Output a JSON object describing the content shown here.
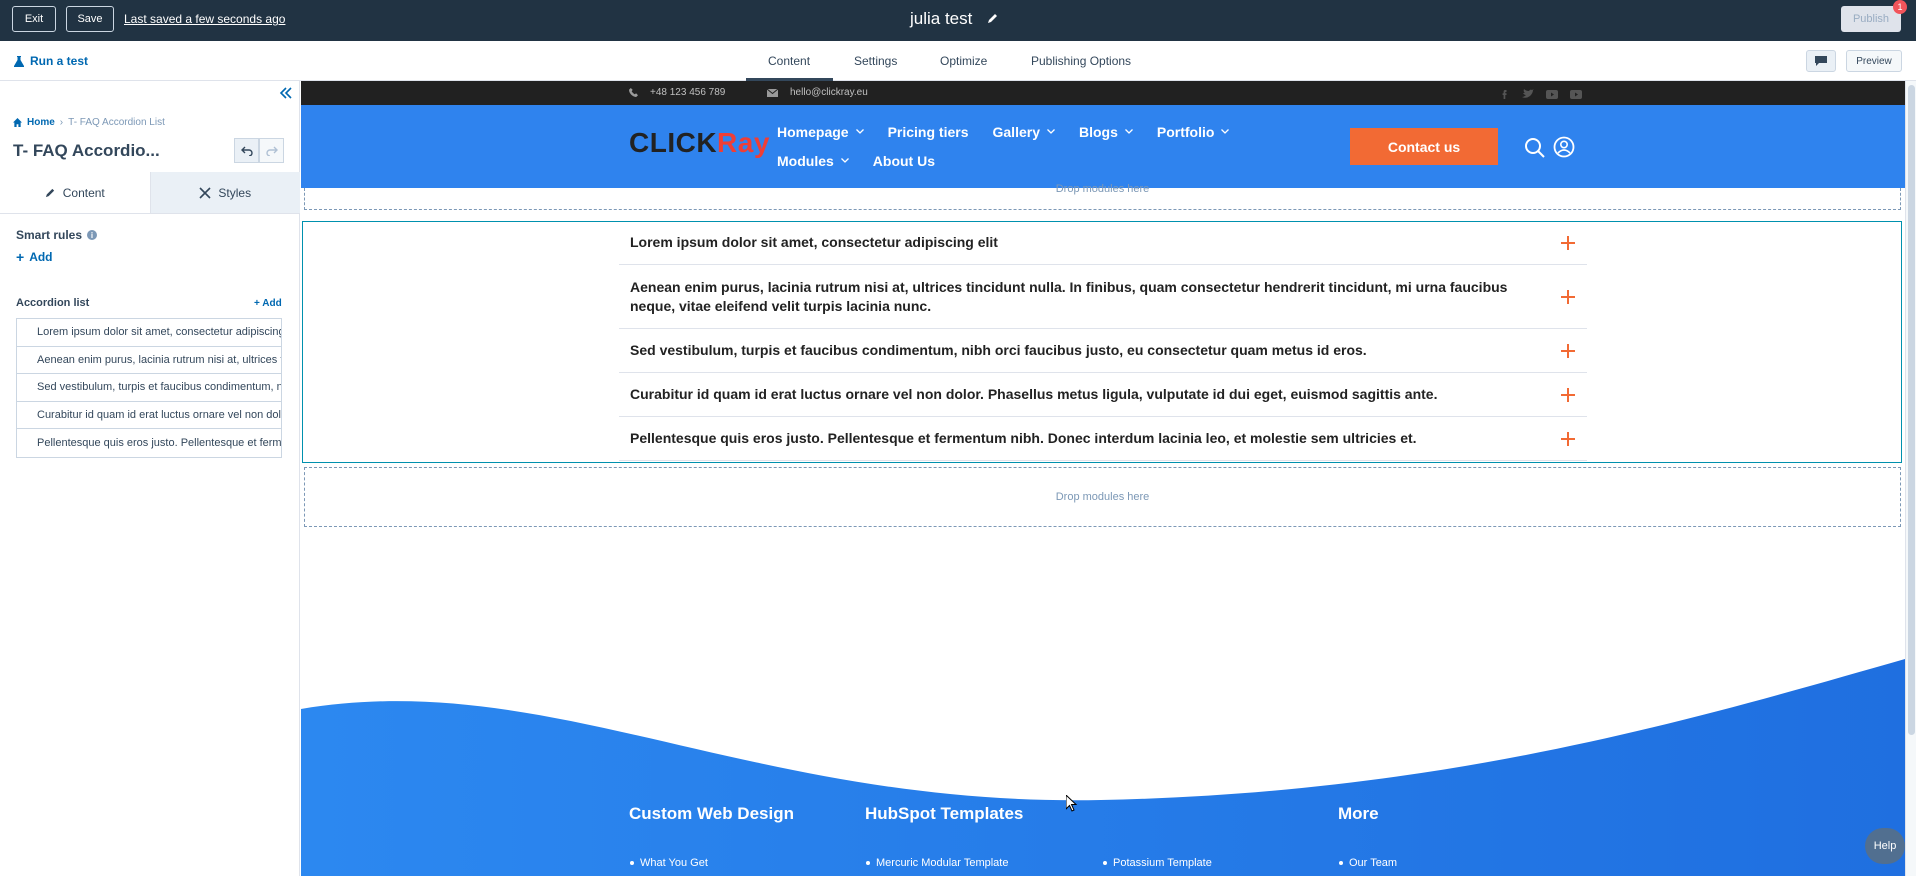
{
  "topbar": {
    "exit_label": "Exit",
    "save_label": "Save",
    "saved_status": "Last saved a few seconds ago",
    "page_title": "julia test",
    "publish_label": "Publish",
    "notification_count": "1"
  },
  "subbar": {
    "run_test_label": "Run a test",
    "tabs": [
      "Content",
      "Settings",
      "Optimize",
      "Publishing Options"
    ],
    "active_tab": "Content",
    "preview_label": "Preview"
  },
  "sidebar": {
    "breadcrumb": {
      "home": "Home",
      "current": "T- FAQ Accordion List"
    },
    "module_title": "T- FAQ Accordio...",
    "tabs": {
      "content": "Content",
      "styles": "Styles"
    },
    "smart_rules_label": "Smart rules",
    "add_label": "Add",
    "accordion_list_label": "Accordion list",
    "accordion_add_label": "+ Add",
    "accordion_items": [
      "Lorem ipsum dolor sit amet, consectetur adipiscing elit",
      "Aenean enim purus, lacinia rutrum nisi at, ultrices tincidunt nulla.",
      "Sed vestibulum, turpis et faucibus condimentum, nibh orci",
      "Curabitur id quam id erat luctus ornare vel non dolor.",
      "Pellentesque quis eros justo. Pellentesque et fermentum nibh."
    ]
  },
  "site": {
    "phone": "+48 123 456 789",
    "email": "hello@clickray.eu",
    "logo_main": "CLICK",
    "logo_accent": "Ray",
    "nav_row1": [
      "Homepage",
      "Pricing tiers",
      "Gallery",
      "Blogs",
      "Portfolio"
    ],
    "nav_row2": [
      "Modules",
      "About Us"
    ],
    "contact_label": "Contact us",
    "drop_modules_label": "Drop modules here",
    "faq_questions": [
      "Lorem ipsum dolor sit amet, consectetur adipiscing elit",
      "Aenean enim purus, lacinia rutrum nisi at, ultrices tincidunt nulla. In finibus, quam consectetur hendrerit tincidunt, mi urna faucibus neque, vitae eleifend velit turpis lacinia nunc.",
      "Sed vestibulum, turpis et faucibus condimentum, nibh orci faucibus justo, eu consectetur quam metus id eros.",
      "Curabitur id quam id erat luctus ornare vel non dolor. Phasellus metus ligula, vulputate id dui eget, euismod sagittis ante.",
      "Pellentesque quis eros justo. Pellentesque et fermentum nibh. Donec interdum lacinia leo, et molestie sem ultricies et."
    ],
    "footer": {
      "col1_heading": "Custom Web Design",
      "col2_heading": "HubSpot Templates",
      "col3_heading": "More",
      "col1_link": "What You Get",
      "col2_link_a": "Mercuric Modular Template",
      "col2_link_b": "Potassium Template",
      "col3_link": "Our Team"
    }
  },
  "help_label": "Help",
  "colors": {
    "topbar_bg": "#213343",
    "site_blue": "#2f83ee",
    "contact_orange": "#f26a34",
    "plus_orange": "#f26a34",
    "link_blue": "#0068b1"
  }
}
